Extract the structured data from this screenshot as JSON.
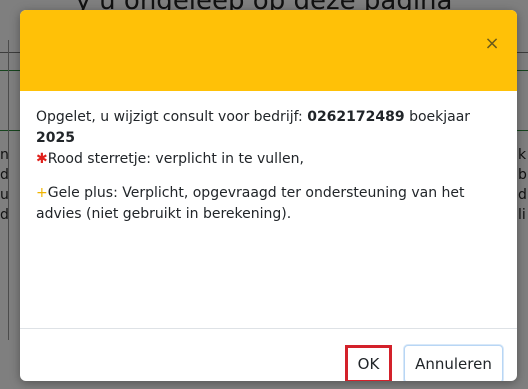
{
  "background": {
    "title_fragment": "y u ongeleep op deze pagina"
  },
  "modal": {
    "close_symbol": "×",
    "line1_prefix": "Opgelet, u wijzigt consult voor bedrijf: ",
    "company_number": "0262172489",
    "line1_middle": " boekjaar",
    "year": "2025",
    "red_symbol": "✱",
    "red_text": "Rood sterretje: verplicht in te vullen,",
    "yellow_symbol": "+",
    "yellow_text": "Gele plus: Verplicht, opgevraagd ter ondersteuning van het advies (niet gebruikt in berekening).",
    "ok_label": "OK",
    "cancel_label": "Annuleren"
  },
  "colors": {
    "header": "#ffc107",
    "required_star": "#e0201b",
    "yellow_plus": "#f0b400",
    "ok_highlight": "#d3212a"
  }
}
